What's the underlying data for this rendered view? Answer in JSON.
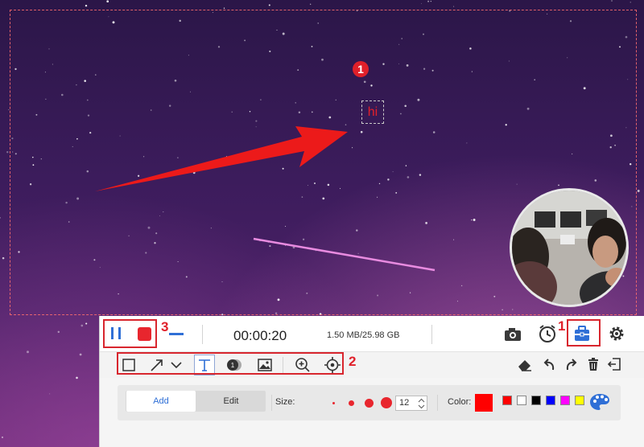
{
  "screen": {
    "marker_number": "1",
    "annotation_text": "hi"
  },
  "toolbar": {
    "timer": "00:00:20",
    "file_size": "1.50 MB/25.98 GB",
    "callouts": {
      "one": "1",
      "two": "2",
      "three": "3"
    }
  },
  "annotate": {
    "tabs": {
      "add": "Add",
      "edit": "Edit"
    },
    "size_label": "Size:",
    "size_value": "12",
    "color_label": "Color:",
    "current_color": "#ff0000",
    "palette": [
      "#ff0000",
      "#ffffff",
      "#000000",
      "#0000ff",
      "#ff00ff",
      "#ffff00"
    ],
    "accent": "#2f6fd6"
  }
}
